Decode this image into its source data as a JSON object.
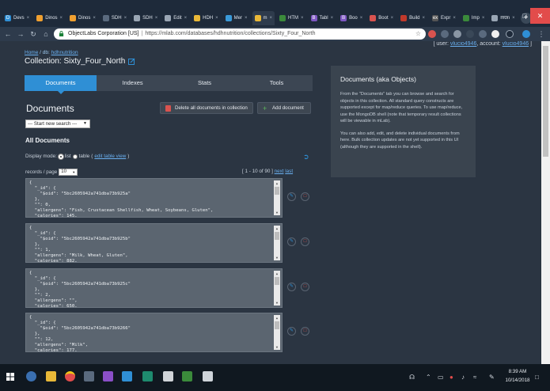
{
  "browser": {
    "tabs": [
      {
        "label": "Devs",
        "fav": "D",
        "color": "#2f8fd5",
        "active": false
      },
      {
        "label": "Dinos",
        "fav": "",
        "color": "#f0a030",
        "active": false
      },
      {
        "label": "Dinos",
        "fav": "",
        "color": "#f0a030",
        "active": false
      },
      {
        "label": "SDH",
        "fav": "",
        "color": "#5a6a7e",
        "active": false
      },
      {
        "label": "SDH",
        "fav": "",
        "color": "#9aa6b4",
        "active": false
      },
      {
        "label": "Edit",
        "fav": "",
        "color": "#9aa6b4",
        "active": false
      },
      {
        "label": "HDH",
        "fav": "",
        "color": "#e9b838",
        "active": false
      },
      {
        "label": "Mer",
        "fav": "",
        "color": "#3a9ad9",
        "active": false
      },
      {
        "label": "m",
        "fav": "",
        "color": "#e9b838",
        "active": true
      },
      {
        "label": "HTM",
        "fav": "",
        "color": "#3b8a3b",
        "active": false
      },
      {
        "label": "Tabl",
        "fav": "B",
        "color": "#7e57c2",
        "active": false
      },
      {
        "label": "Boo",
        "fav": "B",
        "color": "#7e57c2",
        "active": false
      },
      {
        "label": "Boot",
        "fav": "",
        "color": "#d9534f",
        "active": false
      },
      {
        "label": "Build",
        "fav": "",
        "color": "#c0392b",
        "active": false
      },
      {
        "label": "Expr",
        "fav": "ex",
        "color": "#555",
        "active": false
      },
      {
        "label": "Imp",
        "fav": "",
        "color": "#3b8a3b",
        "active": false
      },
      {
        "label": "mon",
        "fav": "",
        "color": "#9aa6b4",
        "active": false
      }
    ],
    "site_name": "ObjectLabs Corporation [US]",
    "url": "https://mlab.com/databases/hdhnutrition/collections/Sixty_Four_North"
  },
  "user": {
    "prefix": "[ user: ",
    "user_link": "vlucio4946",
    "mid": ", account: ",
    "account_link": "vlucio4946",
    "suffix": " ]"
  },
  "breadcrumb": {
    "home": "Home",
    "mid": " / db: ",
    "db": "hdhnutrition"
  },
  "collection_title": "Collection: Sixty_Four_North",
  "tabs": [
    "Documents",
    "Indexes",
    "Stats",
    "Tools"
  ],
  "documents": {
    "heading": "Documents",
    "delete_all_label": "Delete all documents in collection",
    "add_label": "Add document",
    "search_select": "--- Start new search ---",
    "all_docs_heading": "All Documents",
    "display_mode_label": "Display mode:",
    "list_label": "list",
    "table_label": "table",
    "edit_table_view": "edit table view",
    "records_per_page_label": "records / page",
    "records_per_page_value": "10",
    "pager_range": "[ 1 - 10 of 90 ]",
    "pager_next": "next",
    "pager_last": "last"
  },
  "doc_list": [
    {
      "oid": "5bc2605942a741dba73b925a",
      "idx": "0",
      "allergens": "\"Fish, Crustacean Shellfish, Wheat, Soybeans, Gluten\"",
      "calories": "145"
    },
    {
      "oid": "5bc2605942a741dba73b925b",
      "idx": "1",
      "allergens": "\"Milk, Wheat, Gluten\"",
      "calories": "882"
    },
    {
      "oid": "5bc2605942a741dba73b925c",
      "idx": "2",
      "allergens": "\"\"",
      "calories": "650"
    },
    {
      "oid": "5bc2605942a741dba73b9266",
      "idx": "12",
      "allergens": "\"Milk\"",
      "calories": "177"
    }
  ],
  "side_panel": {
    "title": "Documents (aka Objects)",
    "p1": "From the \"Documents\" tab you can browse and search for objects in this collection. All standard query constructs are supported except for map/reduce queries. To use map/reduce, use the MongoDB shell (note that temporary result collections will be viewable in mLab).",
    "p2": "You can also add, edit, and delete individual documents from here. Bulk collection updates are not yet supported in this UI (although they are supported in the shell)."
  },
  "taskbar": {
    "time": "8:39 AM",
    "date": "10/14/2018"
  },
  "colors": {
    "accent": "#2f8fd5",
    "page_bg": "#2b3542",
    "danger": "#d9534f",
    "success": "#5cb85c"
  }
}
